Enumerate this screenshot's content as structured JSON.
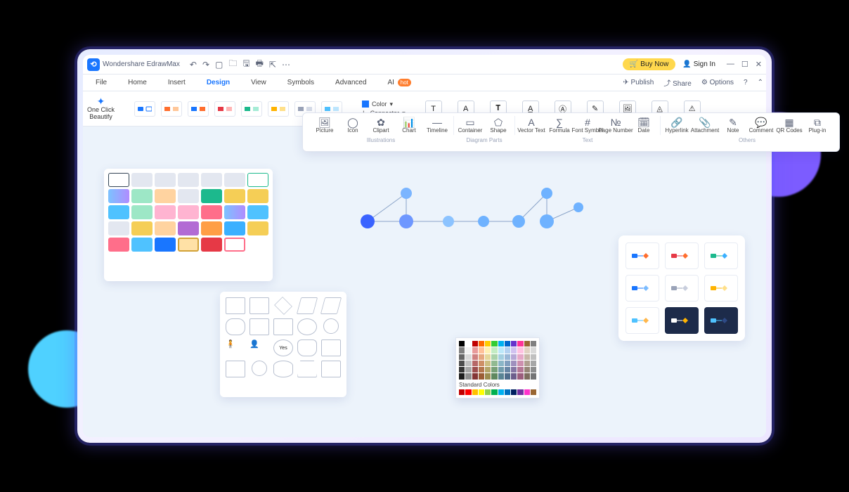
{
  "app_title": "Wondershare EdrawMax",
  "titlebar": {
    "buy_label": "Buy Now",
    "signin_label": "Sign In"
  },
  "menus": {
    "items": [
      "File",
      "Home",
      "Insert",
      "Design",
      "View",
      "Symbols",
      "Advanced",
      "AI"
    ],
    "active": "Design",
    "hot_badge": "hot",
    "right": {
      "publish": "Publish",
      "share": "Share",
      "options": "Options"
    }
  },
  "ribbon": {
    "oneclick_l1": "One Click",
    "oneclick_l2": "Beautify",
    "color_label": "Color",
    "connector_label": "Connector"
  },
  "insertbar": {
    "groups": [
      {
        "label": "Illustrations",
        "items": [
          "Picture",
          "Icon",
          "Clipart",
          "Chart",
          "Timeline"
        ]
      },
      {
        "label": "Diagram Parts",
        "items": [
          "Container",
          "Shape"
        ]
      },
      {
        "label": "Text",
        "items": [
          "Vector Text",
          "Formula",
          "Font Symbol",
          "Page Number",
          "Date"
        ]
      },
      {
        "label": "Others",
        "items": [
          "Hyperlink",
          "Attachment",
          "Note",
          "Comment",
          "QR Codes",
          "Plug-in"
        ]
      }
    ]
  },
  "colorpicker": {
    "standard_label": "Standard Colors"
  },
  "theme_colors": {
    "row0": [
      "#000000",
      "#ffffff",
      "#c00000",
      "#ff6600",
      "#ffcc00",
      "#33cc33",
      "#00b0f0",
      "#0066cc",
      "#6633cc",
      "#ff3399",
      "#996633",
      "#808080"
    ],
    "shade_base": [
      "#7f7f7f",
      "#f2f2f2",
      "#e89a9a",
      "#ffc199",
      "#fff0b3",
      "#c3ecc3",
      "#bde8f9",
      "#b3d1f0",
      "#d1c2f0",
      "#ffc2e1",
      "#e1d1c2",
      "#d9d9d9"
    ],
    "standard": [
      "#c00000",
      "#ff0000",
      "#ffc000",
      "#ffff00",
      "#92d050",
      "#00b050",
      "#00b0f0",
      "#0070c0",
      "#002060",
      "#7030a0",
      "#ff33cc",
      "#996633"
    ]
  },
  "theme_styles": [
    {
      "c1": "#1976ff",
      "c2": "#ff6e2e",
      "bg": "#fff"
    },
    {
      "c1": "#e63946",
      "c2": "#ff6e2e",
      "bg": "#fff"
    },
    {
      "c1": "#1cb98d",
      "c2": "#3bb0ff",
      "bg": "#fff"
    },
    {
      "c1": "#1976ff",
      "c2": "#7bbcff",
      "bg": "#fff"
    },
    {
      "c1": "#9aa3b8",
      "c2": "#c8cedd",
      "bg": "#fff"
    },
    {
      "c1": "#ffb300",
      "c2": "#ffe08a",
      "bg": "#fff"
    },
    {
      "c1": "#4fc2ff",
      "c2": "#ffb74d",
      "bg": "#fff"
    },
    {
      "c1": "#ffffff",
      "c2": "#ffb300",
      "bg": "#1d2b4a"
    },
    {
      "c1": "#4fc2ff",
      "c2": "#2e4a86",
      "bg": "#1d2b4a"
    }
  ]
}
